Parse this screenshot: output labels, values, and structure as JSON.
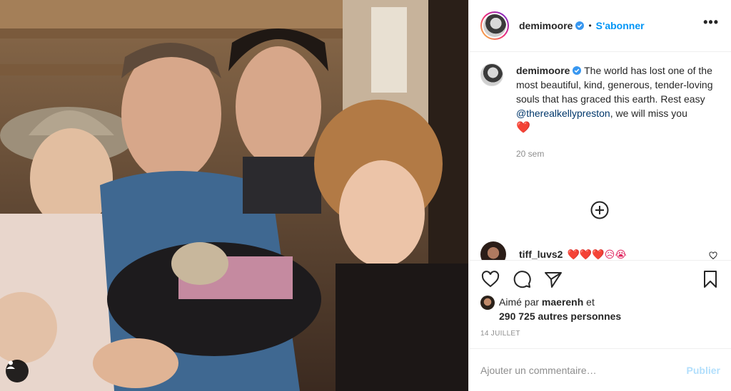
{
  "post": {
    "username": "demimoore",
    "verified": true,
    "separator": "•",
    "follow_label": "S'abonner",
    "more_label": "•••"
  },
  "caption": {
    "username": "demimoore",
    "text": "The world has lost one of the most beautiful, kind, generous, tender-loving souls that has graced this earth. Rest easy",
    "mention": "@therealkellypreston",
    "text_end": ", we will miss you",
    "emoji": "❤️",
    "time": "20 sem"
  },
  "comment": {
    "username": "tiff_luvs2",
    "text": "❤️❤️❤️😥😭"
  },
  "likes": {
    "prefix": "Aimé par",
    "user": "maerenh",
    "connector": "et",
    "count": "290 725 autres personnes"
  },
  "date": "14 JUILLET",
  "add_comment": {
    "placeholder": "Ajouter un commentaire…",
    "publish_label": "Publier"
  },
  "icons": {
    "like": "heart-icon",
    "comment": "comment-icon",
    "share": "share-icon",
    "save": "bookmark-icon",
    "load_more": "plus-circle-icon",
    "tags": "user-tag-icon"
  },
  "colors": {
    "accent": "#0095f6",
    "mention": "#00376b",
    "muted": "#8e8e8e",
    "publish_disabled": "#b2dffc"
  }
}
